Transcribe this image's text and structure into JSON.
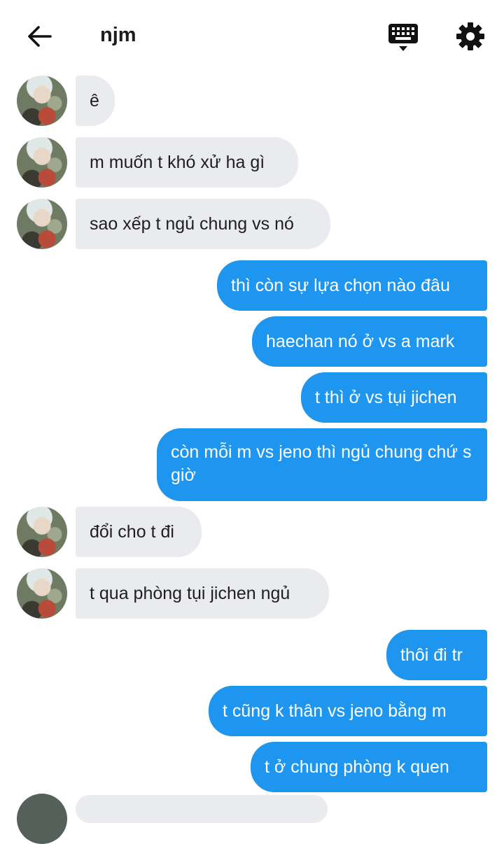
{
  "header": {
    "title": "njm",
    "icons": [
      "arrow-left-icon",
      "keyboard-icon",
      "gear-icon"
    ]
  },
  "colors": {
    "incoming_bubble": "#e9ebef",
    "outgoing_bubble": "#1e96f0",
    "text_dark": "#1c1c1c"
  },
  "messages": [
    {
      "direction": "in",
      "text": "ê"
    },
    {
      "direction": "in",
      "text": "m muốn t khó xử ha gì"
    },
    {
      "direction": "in",
      "text": "sao xếp t ngủ chung vs nó"
    },
    {
      "direction": "out",
      "text": "thì còn sự lựa chọn nào đâu"
    },
    {
      "direction": "out",
      "text": "haechan nó ở vs a mark"
    },
    {
      "direction": "out",
      "text": "t thì ở vs tụi jichen"
    },
    {
      "direction": "out",
      "text": "còn mỗi m vs jeno thì ngủ chung chứ s giờ"
    },
    {
      "direction": "in",
      "text": "đổi cho t đi"
    },
    {
      "direction": "in",
      "text": "t qua phòng tụi jichen ngủ"
    },
    {
      "direction": "out",
      "text": "thôi đi tr"
    },
    {
      "direction": "out",
      "text": "t cũng k thân vs jeno bằng m"
    },
    {
      "direction": "out",
      "text": "t ở chung phòng k quen"
    }
  ]
}
